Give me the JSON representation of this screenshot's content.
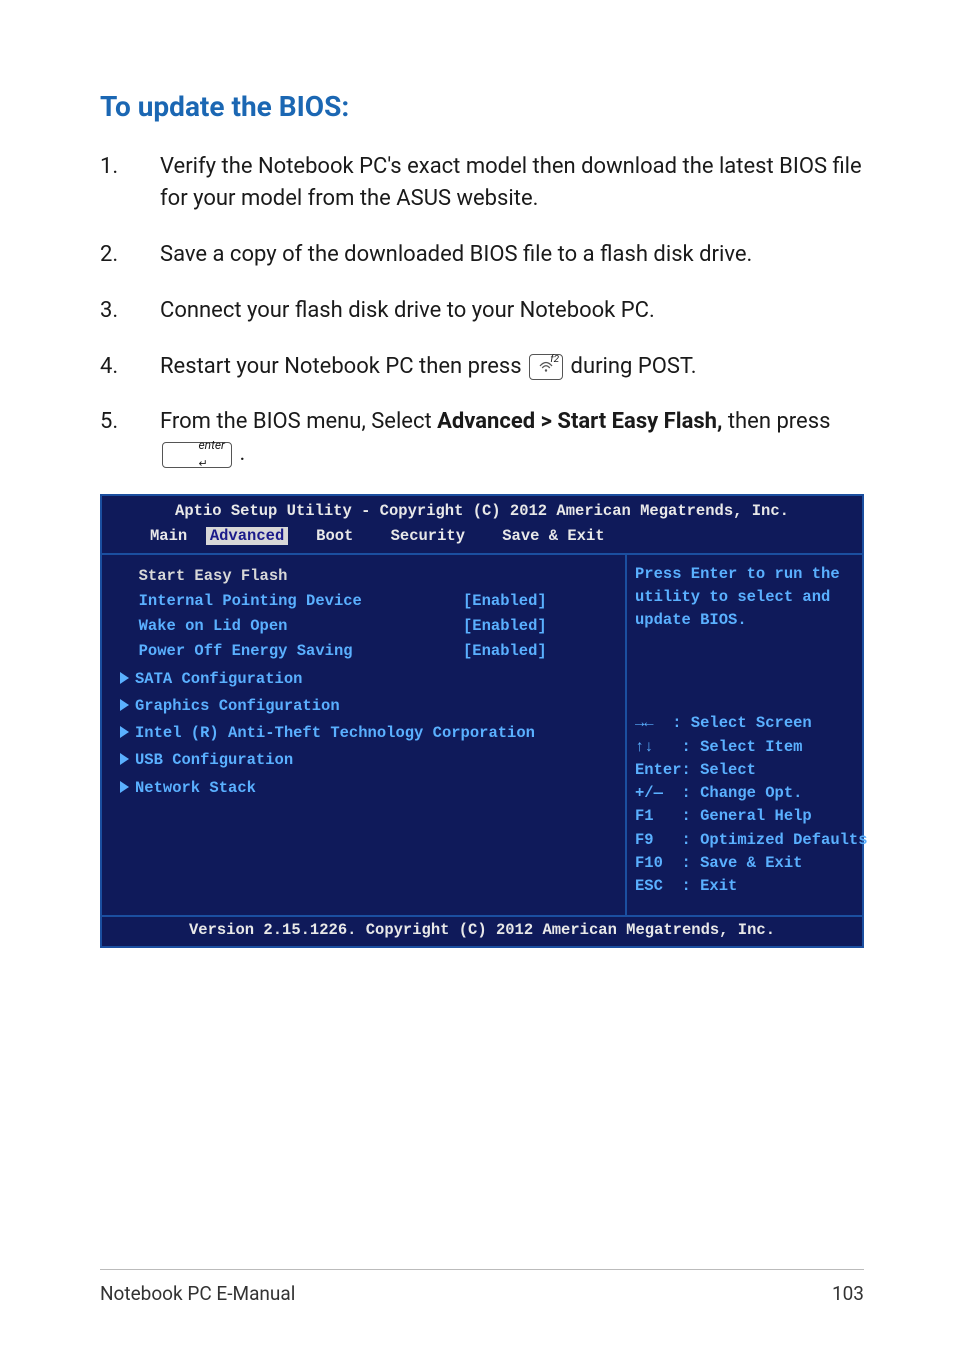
{
  "heading": "To update the BIOS:",
  "steps": {
    "s1_num": "1.",
    "s1": "Verify the Notebook PC's exact model then download the latest BIOS file for your model from the ASUS website.",
    "s2_num": "2.",
    "s2": "Save a copy of the downloaded BIOS file to a flash disk drive.",
    "s3_num": "3.",
    "s3": "Connect your flash disk drive to your Notebook PC.",
    "s4_num": "4.",
    "s4_a": "Restart your Notebook PC then press ",
    "s4_key": "f2",
    "s4_b": " during POST.",
    "s5_num": "5.",
    "s5_a": "From the BIOS menu, Select ",
    "s5_bold": "Advanced > Start Easy Flash,",
    "s5_b": " then press ",
    "s5_key": "enter",
    "s5_c": "."
  },
  "bios": {
    "header": "Aptio Setup Utility - Copyright (C) 2012 American Megatrends, Inc.",
    "tabs": {
      "main": "Main",
      "advanced": "Advanced",
      "boot": "Boot",
      "security": "Security",
      "save": "Save & Exit"
    },
    "rows": {
      "r0_label": "Start Easy Flash",
      "r1_label": "Internal Pointing Device",
      "r1_val": "[Enabled]",
      "r2_label": "Wake on Lid Open",
      "r2_val": "[Enabled]",
      "r3_label": "Power Off Energy Saving",
      "r3_val": "[Enabled]",
      "r4_label": "SATA Configuration",
      "r5_label": "Graphics Configuration",
      "r6_label": "Intel (R) Anti-Theft Technology Corporation",
      "r7_label": "USB Configuration",
      "r8_label": "Network Stack"
    },
    "help_top": "Press Enter to run the utility to select and update BIOS.",
    "help": {
      "h1": "→←  : Select Screen",
      "h2": "↑↓   : Select Item",
      "h3": "Enter: Select",
      "h4": "+/—  : Change Opt.",
      "h5": "F1   : General Help",
      "h6": "F9   : Optimized Defaults",
      "h7": "F10  : Save & Exit",
      "h8": "ESC  : Exit"
    },
    "footer": "Version 2.15.1226. Copyright (C) 2012 American Megatrends, Inc."
  },
  "footer": {
    "left": "Notebook PC E-Manual",
    "right": "103"
  }
}
